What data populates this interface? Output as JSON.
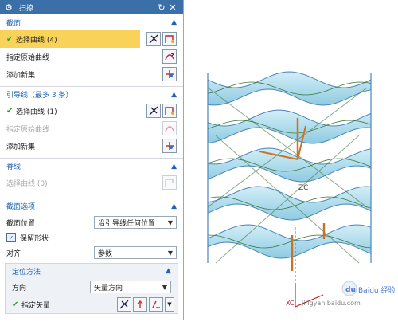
{
  "window": {
    "title": "扫掠"
  },
  "section_profile": {
    "title": "截面",
    "select_curve": "选择曲线 (4)",
    "specify_origin": "指定原始曲线",
    "add_new_set": "添加新集"
  },
  "section_guide": {
    "title": "引导线（最多 3 条）",
    "select_curve": "选择曲线 (1)",
    "specify_origin": "指定原始曲线",
    "add_new_set": "添加新集"
  },
  "section_spine": {
    "title": "脊线",
    "select_curve": "选择曲线 (0)"
  },
  "section_options": {
    "title": "截面选项",
    "position_label": "截面位置",
    "position_value": "沿引导线任何位置",
    "preserve_shape": "保留形状",
    "align_label": "对齐",
    "align_value": "参数",
    "orient_method": {
      "title": "定位方法",
      "direction_label": "方向",
      "direction_value": "矢量方向",
      "specify_vector": "指定矢量"
    }
  },
  "viewport": {
    "axis_x": "XC",
    "axis_z": "ZC",
    "watermark_brand": "Baidu 经验",
    "watermark_url": "jingyan.baidu.com"
  },
  "colors": {
    "title_bar": "#3b6fa8",
    "section_header": "#1f63b6",
    "selected_row": "#f9d25a",
    "check": "#27a327",
    "surface_fill": "#a9dced",
    "surface_edge": "#4a86b8"
  }
}
